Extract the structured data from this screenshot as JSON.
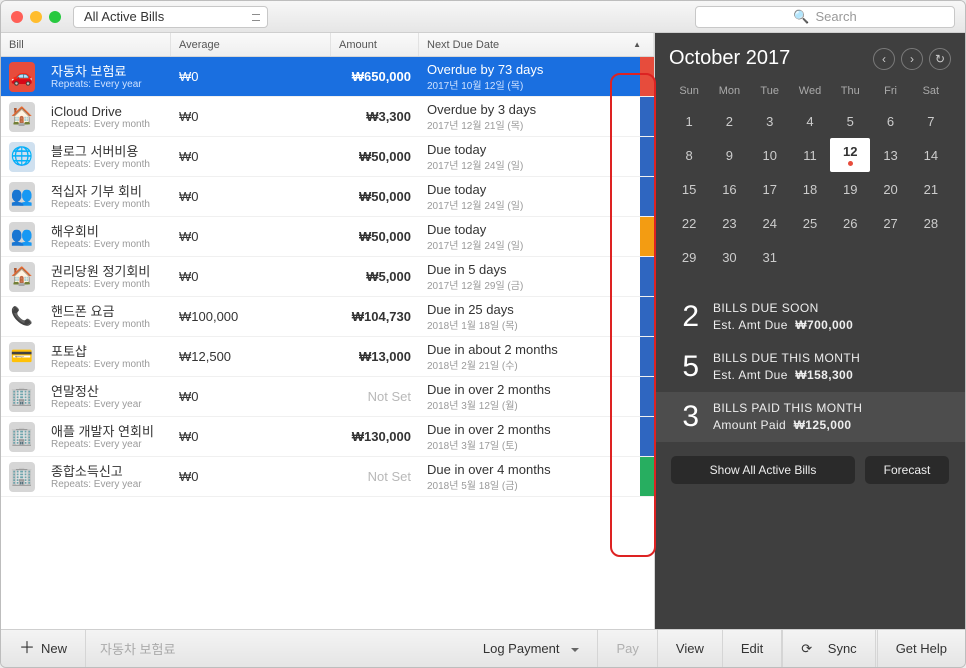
{
  "toolbar": {
    "filter": "All Active Bills",
    "search_placeholder": "Search"
  },
  "columns": {
    "bill": "Bill",
    "average": "Average",
    "amount": "Amount",
    "due": "Next Due Date"
  },
  "bills": [
    {
      "name": "자동차 보험료",
      "repeats": "Repeats: Every year",
      "avg": "₩0",
      "amount": "₩650,000",
      "due": "Overdue by 73 days",
      "date": "2017년 10월 12일 (목)",
      "stripe": "#e74c3c",
      "selected": true,
      "icon": "🚗",
      "ibg": "#e74c3c"
    },
    {
      "name": "iCloud Drive",
      "repeats": "Repeats: Every month",
      "avg": "₩0",
      "amount": "₩3,300",
      "due": "Overdue by 3 days",
      "date": "2017년 12월 21일 (목)",
      "stripe": "#2f66c0",
      "icon": "🏠",
      "ibg": "#d6d6d6"
    },
    {
      "name": "블로그 서버비용",
      "repeats": "Repeats: Every month",
      "avg": "₩0",
      "amount": "₩50,000",
      "due": "Due today",
      "date": "2017년 12월 24일 (일)",
      "stripe": "#2f66c0",
      "icon": "🌐",
      "ibg": "#cfe0ef"
    },
    {
      "name": "적십자 기부 회비",
      "repeats": "Repeats: Every month",
      "avg": "₩0",
      "amount": "₩50,000",
      "due": "Due today",
      "date": "2017년 12월 24일 (일)",
      "stripe": "#2f66c0",
      "icon": "👥",
      "ibg": "#d6d6d6"
    },
    {
      "name": "해우회비",
      "repeats": "Repeats: Every month",
      "avg": "₩0",
      "amount": "₩50,000",
      "due": "Due today",
      "date": "2017년 12월 24일 (일)",
      "stripe": "#f39c12",
      "icon": "👥",
      "ibg": "#d6d6d6"
    },
    {
      "name": "권리당원 정기회비",
      "repeats": "Repeats: Every month",
      "avg": "₩0",
      "amount": "₩5,000",
      "due": "Due in 5 days",
      "date": "2017년 12월 29일 (금)",
      "stripe": "#2f66c0",
      "icon": "🏠",
      "ibg": "#d6d6d6"
    },
    {
      "name": "핸드폰 요금",
      "repeats": "Repeats: Every month",
      "avg": "₩100,000",
      "amount": "₩104,730",
      "due": "Due in 25 days",
      "date": "2018년 1월 18일 (목)",
      "stripe": "#2f66c0",
      "icon": "📞",
      "ibg": "#fff"
    },
    {
      "name": "포토샵",
      "repeats": "Repeats: Every month",
      "avg": "₩12,500",
      "amount": "₩13,000",
      "due": "Due in about 2 months",
      "date": "2018년 2월 21일 (수)",
      "stripe": "#2f66c0",
      "icon": "💳",
      "ibg": "#d6d6d6"
    },
    {
      "name": "연말정산",
      "repeats": "Repeats: Every year",
      "avg": "₩0",
      "amount": "Not Set",
      "notset": true,
      "due": "Due in over 2 months",
      "date": "2018년 3월 12일 (월)",
      "stripe": "#2f66c0",
      "icon": "🏢",
      "ibg": "#d6d6d6"
    },
    {
      "name": "애플 개발자 연회비",
      "repeats": "Repeats: Every year",
      "avg": "₩0",
      "amount": "₩130,000",
      "due": "Due in over 2 months",
      "date": "2018년 3월 17일 (토)",
      "stripe": "#2f66c0",
      "icon": "🏢",
      "ibg": "#d6d6d6"
    },
    {
      "name": "종합소득신고",
      "repeats": "Repeats: Every year",
      "avg": "₩0",
      "amount": "Not Set",
      "notset": true,
      "due": "Due in over 4 months",
      "date": "2018년 5월 18일 (금)",
      "stripe": "#27ae60",
      "icon": "🏢",
      "ibg": "#d6d6d6"
    }
  ],
  "calendar": {
    "month": "October 2017",
    "dow": [
      "Sun",
      "Mon",
      "Tue",
      "Wed",
      "Thu",
      "Fri",
      "Sat"
    ],
    "weeks": [
      [
        {
          "n": "1"
        },
        {
          "n": "2"
        },
        {
          "n": "3"
        },
        {
          "n": "4"
        },
        {
          "n": "5"
        },
        {
          "n": "6"
        },
        {
          "n": "7"
        }
      ],
      [
        {
          "n": "8"
        },
        {
          "n": "9"
        },
        {
          "n": "10"
        },
        {
          "n": "11"
        },
        {
          "n": "12",
          "today": true,
          "dot": true
        },
        {
          "n": "13"
        },
        {
          "n": "14"
        }
      ],
      [
        {
          "n": "15"
        },
        {
          "n": "16"
        },
        {
          "n": "17"
        },
        {
          "n": "18"
        },
        {
          "n": "19"
        },
        {
          "n": "20"
        },
        {
          "n": "21"
        }
      ],
      [
        {
          "n": "22"
        },
        {
          "n": "23"
        },
        {
          "n": "24"
        },
        {
          "n": "25"
        },
        {
          "n": "26"
        },
        {
          "n": "27"
        },
        {
          "n": "28"
        }
      ],
      [
        {
          "n": "29"
        },
        {
          "n": "30"
        },
        {
          "n": "31"
        },
        {
          "n": "",
          "dim": true
        },
        {
          "n": "",
          "dim": true
        },
        {
          "n": "",
          "dim": true
        },
        {
          "n": "",
          "dim": true
        }
      ]
    ]
  },
  "summary": [
    {
      "n": "2",
      "t": "BILLS DUE SOON",
      "s": "Est. Amt Due",
      "a": "₩700,000"
    },
    {
      "n": "5",
      "t": "BILLS DUE THIS MONTH",
      "s": "Est. Amt Due",
      "a": "₩158,300"
    },
    {
      "n": "3",
      "t": "BILLS PAID THIS MONTH",
      "s": "Amount Paid",
      "a": "₩125,000",
      "hl": true
    }
  ],
  "sidebar_buttons": {
    "show_all": "Show All Active Bills",
    "forecast": "Forecast"
  },
  "footer": {
    "new": "New",
    "selected": "자동차 보험료",
    "log": "Log Payment",
    "pay": "Pay",
    "view": "View",
    "edit": "Edit",
    "sync": "Sync",
    "help": "Get Help"
  }
}
